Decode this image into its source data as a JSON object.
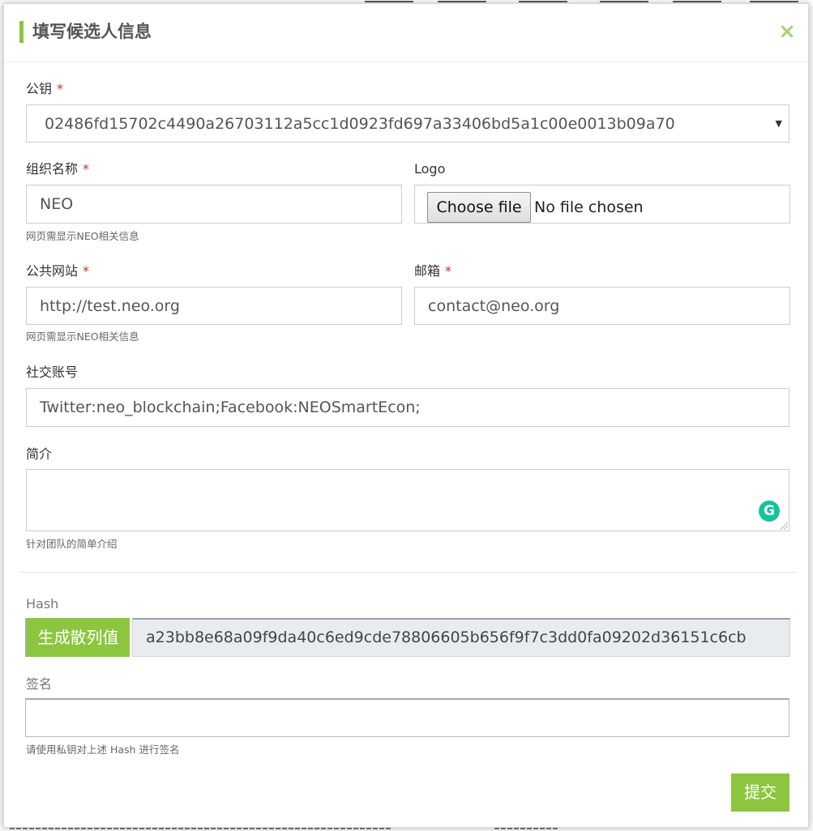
{
  "modal": {
    "title": "填写候选人信息",
    "close_glyph": "×"
  },
  "form": {
    "public_key": {
      "label": "公钥",
      "required_mark": "*",
      "selected": "02486fd15702c4490a26703112a5cc1d0923fd697a33406bd5a1c00e0013b09a70",
      "caret": "▼"
    },
    "org_name": {
      "label": "组织名称",
      "required_mark": "*",
      "value": "NEO",
      "help": "网页需显示NEO相关信息"
    },
    "logo": {
      "label": "Logo",
      "button": "Choose file",
      "status": "No file chosen"
    },
    "website": {
      "label": "公共网站",
      "required_mark": "*",
      "value": "http://test.neo.org",
      "help": "网页需显示NEO相关信息"
    },
    "email": {
      "label": "邮箱",
      "required_mark": "*",
      "value": "contact@neo.org"
    },
    "social": {
      "label": "社交账号",
      "value": "Twitter:neo_blockchain;Facebook:NEOSmartEcon;"
    },
    "intro": {
      "label": "简介",
      "value": "",
      "help": "针对团队的简单介绍",
      "grammarly_glyph": "G"
    },
    "hash": {
      "label": "Hash",
      "button": "生成散列值",
      "value": "a23bb8e68a09f9da40c6ed9cde78806605b656f9f7c3dd0fa09202d36151c6cb"
    },
    "signature": {
      "label": "签名",
      "value": "",
      "help": "请使用私钥对上述 Hash 进行签名"
    },
    "submit": "提交"
  },
  "icons": {
    "close": "close-icon",
    "dropdown": "chevron-down-icon",
    "grammarly": "grammarly-icon"
  },
  "colors": {
    "accent": "#8cc63e",
    "required": "#c9302c",
    "grammarly": "#15c39a"
  }
}
